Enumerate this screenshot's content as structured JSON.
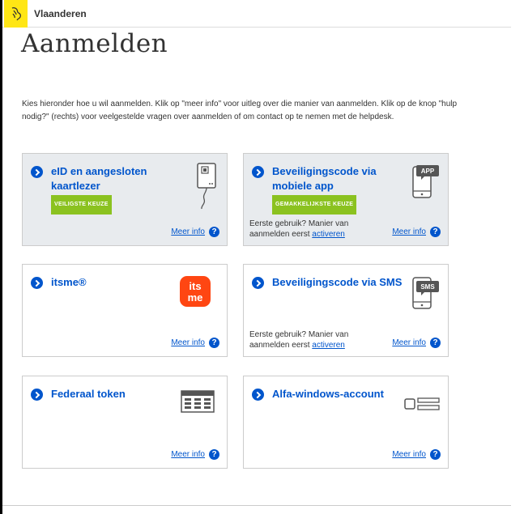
{
  "header": {
    "brand": "Vlaanderen"
  },
  "page": {
    "title": "Aanmelden",
    "intro": "Kies hieronder hoe u wil aanmelden. Klik op \"meer info\" voor uitleg over die manier van aanmelden. Klik op de knop \"hulp nodig?\" (rechts) voor veelgestelde vragen over aanmelden of om contact op te nemen met de helpdesk."
  },
  "cards": [
    {
      "title": "eID en aangesloten kaartlezer",
      "badge": "VEILIGSTE KEUZE",
      "more": "Meer info",
      "icon": "card-reader-icon"
    },
    {
      "title": "Beveiligingscode via mobiele app",
      "badge": "GEMAKKELIJKSTE KEUZE",
      "note": "Eerste gebruik? Manier van aanmelden eerst",
      "link": "activeren",
      "more": "Meer info",
      "icon_text": "APP"
    },
    {
      "title": "itsme®",
      "more": "Meer info",
      "logo_top": "its",
      "logo_bottom": "me"
    },
    {
      "title": "Beveiligingscode via SMS",
      "note": "Eerste gebruik? Manier van aanmelden eerst",
      "link": "activeren",
      "more": "Meer info",
      "icon_text": "SMS"
    },
    {
      "title": "Federaal token",
      "more": "Meer info",
      "icon": "token-grid-icon"
    },
    {
      "title": "Alfa-windows-account",
      "more": "Meer info",
      "icon": "windows-account-icon"
    }
  ],
  "help_glyph": "?",
  "colors": {
    "primary": "#0055cc",
    "badge": "#8bc220",
    "brand": "#ffe615",
    "itsme": "#ff4612",
    "card_grey": "#e8ebee"
  }
}
